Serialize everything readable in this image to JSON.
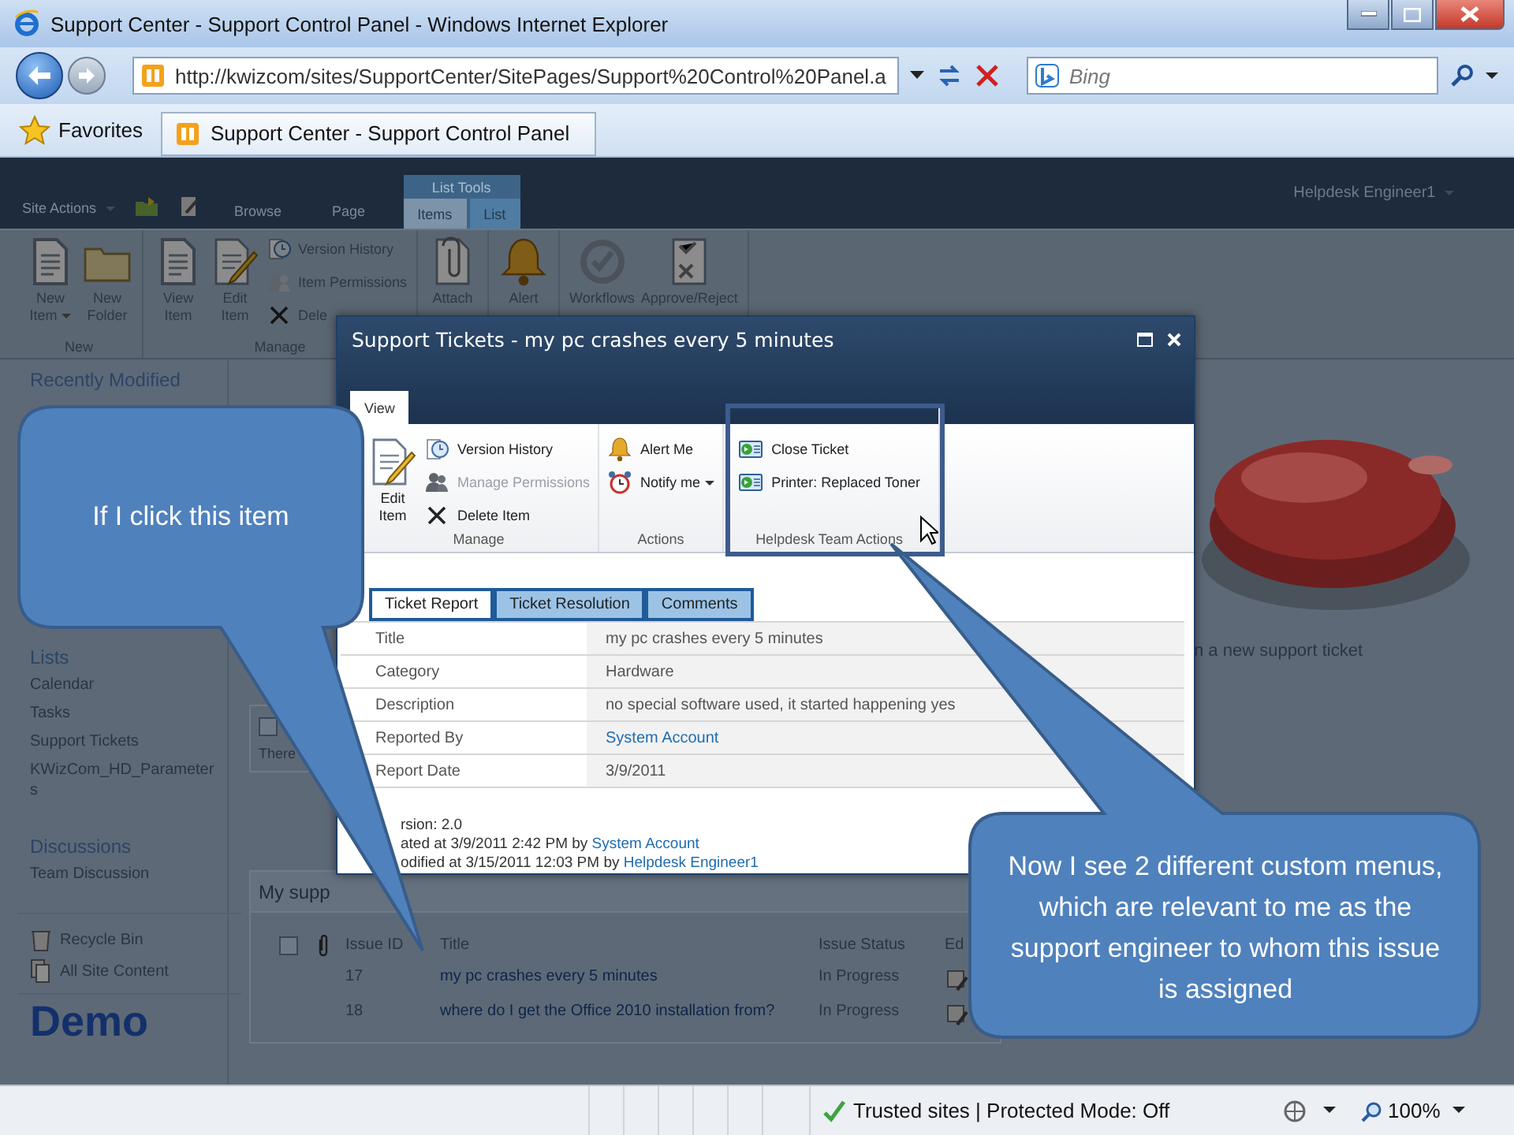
{
  "browser": {
    "title": "Support Center - Support Control Panel - Windows Internet Explorer",
    "address": "http://kwizcom/sites/SupportCenter/SitePages/Support%20Control%20Panel.a",
    "search_placeholder": "Bing",
    "favorites": "Favorites",
    "tab_title": "Support Center - Support Control Panel"
  },
  "site_bar": {
    "site_actions": "Site Actions",
    "tabs": [
      {
        "label": "Browse",
        "selected": false
      },
      {
        "label": "Page",
        "selected": false
      }
    ],
    "context_group": "List Tools",
    "context_tabs": [
      {
        "label": "Items",
        "selected": true
      },
      {
        "label": "List",
        "selected": false
      }
    ],
    "user": "Helpdesk Engineer1"
  },
  "site_ribbon": {
    "groups": [
      {
        "label": "New",
        "commands": [
          {
            "label": "New Item",
            "kind": "large",
            "menu": true
          },
          {
            "label": "New Folder",
            "kind": "large",
            "menu": false
          }
        ]
      },
      {
        "label": "Manage",
        "commands": [
          {
            "label": "View Item",
            "kind": "large",
            "menu": false
          },
          {
            "label": "Edit Item",
            "kind": "large",
            "menu": false
          },
          {
            "label": "Version History",
            "kind": "small",
            "menu": false
          },
          {
            "label": "Item Permissions",
            "kind": "small",
            "menu": false
          },
          {
            "label": "Dele",
            "kind": "small",
            "menu": false
          }
        ]
      },
      {
        "commands": [
          {
            "label": "Attach",
            "kind": "large",
            "menu": false
          }
        ]
      },
      {
        "commands": [
          {
            "label": "Alert",
            "kind": "large",
            "menu": false
          }
        ]
      },
      {
        "commands": [
          {
            "label": "Workflows",
            "kind": "large",
            "menu": false
          },
          {
            "label": "Approve/Reject",
            "kind": "large",
            "menu": false
          }
        ]
      }
    ]
  },
  "nav": {
    "sections": [
      {
        "heading": "Recently Modified"
      },
      {
        "heading": "Lists",
        "items": [
          "Calendar",
          "Tasks",
          "Support Tickets",
          "KWizCom_HD_Parameters"
        ]
      },
      {
        "heading": "Discussions",
        "items": [
          "Team Discussion"
        ]
      }
    ],
    "links": [
      "Recycle Bin",
      "All Site Content"
    ],
    "logo": "Demo"
  },
  "main_page": {
    "notice_box": {
      "text": "There",
      "checked": false
    },
    "side_text": "n a new support ticket",
    "list": {
      "title": "My supp",
      "checked": false,
      "columns": [
        "Issue ID",
        "Title",
        "Issue Status",
        "Ed"
      ],
      "rows": [
        {
          "id": "17",
          "title": "my pc crashes every 5 minutes",
          "status": "In Progress"
        },
        {
          "id": "18",
          "title": "where do I get the Office 2010 installation from?",
          "status": "In Progress"
        }
      ]
    }
  },
  "dialog": {
    "title": "Support Tickets - my pc crashes every 5 minutes",
    "tabs": [
      {
        "label": "View",
        "selected": true
      }
    ],
    "groups": [
      {
        "label": "Manage",
        "highlighted": false,
        "commands": [
          {
            "label": "Edit Item",
            "kind": "large",
            "disabled": false,
            "menu": false
          },
          {
            "label": "Version History",
            "kind": "small",
            "disabled": false,
            "menu": false
          },
          {
            "label": "Manage Permissions",
            "kind": "small",
            "disabled": true,
            "menu": false
          },
          {
            "label": "Delete Item",
            "kind": "small",
            "disabled": false,
            "menu": false
          }
        ]
      },
      {
        "label": "Actions",
        "highlighted": false,
        "commands": [
          {
            "label": "Alert Me",
            "kind": "small",
            "disabled": false,
            "menu": false
          },
          {
            "label": "Notify me",
            "kind": "small",
            "disabled": false,
            "menu": true
          }
        ]
      },
      {
        "label": "Helpdesk Team Actions",
        "highlighted": true,
        "commands": [
          {
            "label": "Close Ticket",
            "kind": "small",
            "disabled": false,
            "menu": false
          },
          {
            "label": "Printer: Replaced Toner",
            "kind": "small",
            "disabled": false,
            "menu": false
          }
        ]
      }
    ],
    "form_tabs": [
      {
        "label": "Ticket Report",
        "selected": true
      },
      {
        "label": "Ticket Resolution",
        "selected": false
      },
      {
        "label": "Comments",
        "selected": false
      }
    ],
    "fields": [
      {
        "label": "Title",
        "value": "my pc crashes every 5 minutes",
        "kind": "text"
      },
      {
        "label": "Category",
        "value": "Hardware",
        "kind": "text"
      },
      {
        "label": "Description",
        "value": "no special software used, it started happening yes",
        "kind": "text"
      },
      {
        "label": "Reported By",
        "value": "System Account",
        "kind": "link"
      },
      {
        "label": "Report Date",
        "value": "3/9/2011",
        "kind": "text"
      }
    ],
    "footer": [
      {
        "text": "rsion: 2.0"
      },
      {
        "text": "ated at 3/9/2011 2:42 PM by ",
        "link": "System Account"
      },
      {
        "text": "odified at 3/15/2011 12:03 PM by ",
        "link": "Helpdesk Engineer1"
      }
    ]
  },
  "callouts": [
    {
      "text": "If I click this item"
    },
    {
      "text": "Now I see 2 different custom menus, which are relevant to me as the support engineer to whom this issue is assigned"
    }
  ],
  "status_bar": {
    "zone": "Trusted sites | Protected Mode: Off",
    "zoom": "100%"
  }
}
